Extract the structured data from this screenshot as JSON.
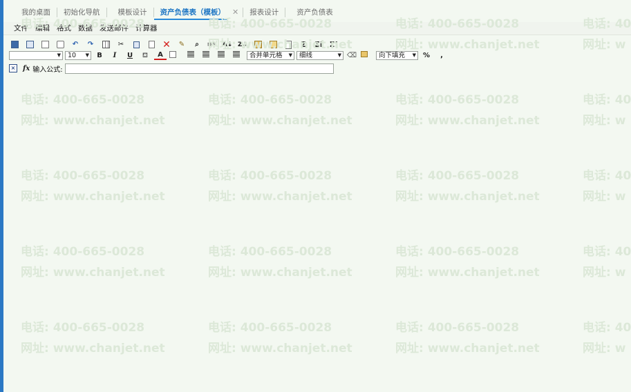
{
  "tabs": [
    {
      "label": "我的桌面",
      "active": false
    },
    {
      "label": "初始化导航",
      "active": false
    },
    {
      "label": "模板设计",
      "active": false
    },
    {
      "label": "资产负债表（模板）",
      "active": true,
      "closable": true
    },
    {
      "label": "报表设计",
      "active": false
    },
    {
      "label": "资产负债表",
      "active": false
    }
  ],
  "tab_close_glyph": "✕",
  "menu": [
    "文件",
    "编辑",
    "格式",
    "数据",
    "发送邮件",
    "计算器"
  ],
  "toolbar": {
    "font_size": "10",
    "bold": "B",
    "italic": "I",
    "underline": "U",
    "font_color": "A",
    "merge_cells": "合并单元格",
    "border_style": "细线",
    "fill_direction": "向下填充",
    "percent": "%",
    "thousands": ",",
    "sigma1": "Σ",
    "sigma2": "ΣI",
    "sigma3": "Σ!"
  },
  "formula": {
    "fx": "fx",
    "label": "输入公式:",
    "value": ""
  },
  "watermark": {
    "phone": "电话: 400-665-0028",
    "phone_partial": "电话: 40",
    "site": "网址: www.chanjet.net",
    "site_partial": "网址: w"
  },
  "colors": {
    "accent": "#1f76c4",
    "left_bar": "#2b78c4",
    "background": "#f3f8f1"
  }
}
